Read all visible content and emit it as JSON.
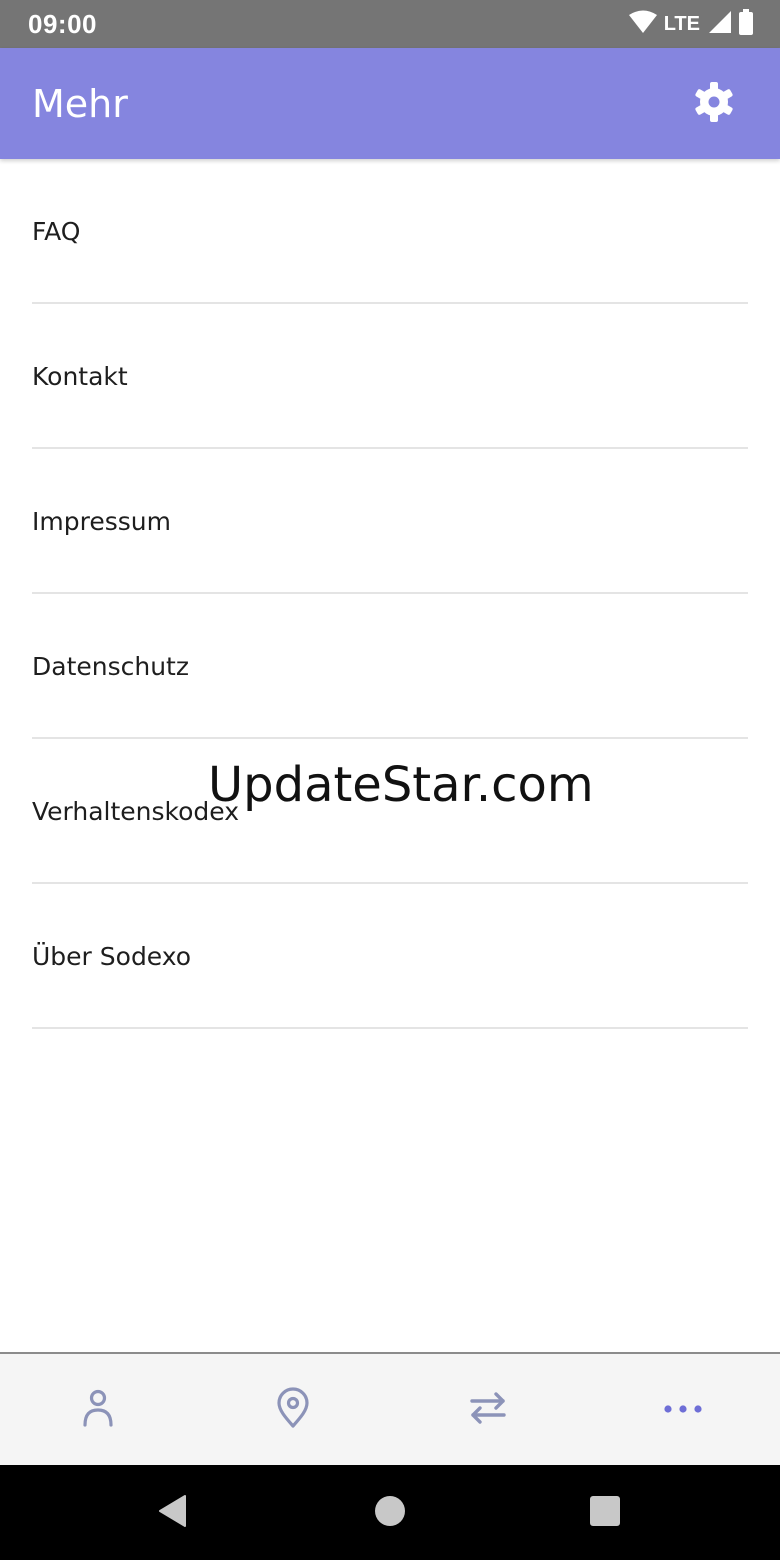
{
  "status_bar": {
    "time": "09:00",
    "network": "LTE",
    "icons": [
      "wifi-icon",
      "cell-signal-icon",
      "battery-icon"
    ]
  },
  "app_bar": {
    "title": "Mehr",
    "settings_icon": "gear-icon"
  },
  "menu": {
    "items": [
      {
        "label": "FAQ"
      },
      {
        "label": "Kontakt"
      },
      {
        "label": "Impressum"
      },
      {
        "label": "Datenschutz"
      },
      {
        "label": "Verhaltenskodex"
      },
      {
        "label": "Über Sodexo"
      }
    ]
  },
  "watermark": "UpdateStar.com",
  "bottom_nav": {
    "items": [
      {
        "icon": "person-icon"
      },
      {
        "icon": "location-pin-icon"
      },
      {
        "icon": "transfer-arrows-icon"
      },
      {
        "icon": "more-dots-icon"
      }
    ]
  },
  "system_nav": {
    "buttons": [
      "back-icon",
      "home-icon",
      "recents-icon"
    ]
  },
  "colors": {
    "status_bar": "#757575",
    "app_bar": "#8585df",
    "accent": "#6e6ed6",
    "nav_icon": "#8c93b8",
    "divider": "#e4e4e4",
    "text": "#1e1e1e"
  }
}
